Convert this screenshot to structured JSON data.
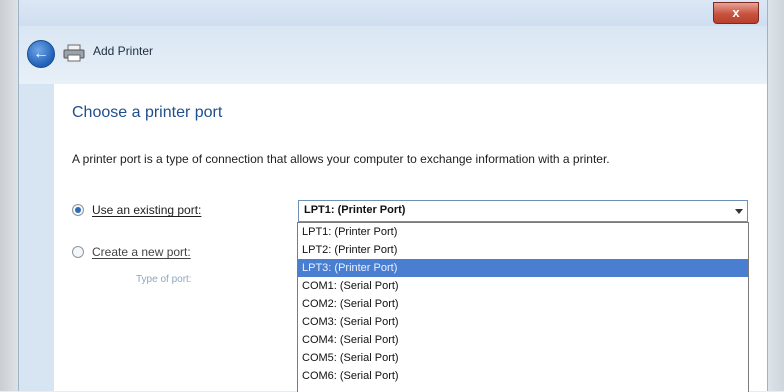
{
  "window": {
    "close_glyph": "x",
    "title": "Add Printer"
  },
  "page": {
    "heading": "Choose a printer port",
    "description": "A printer port is a type of connection that allows your computer to exchange information with a printer."
  },
  "options": {
    "existing_label": "Use an existing port:",
    "existing_selected": true,
    "new_label": "Create a new port:",
    "type_of_port_label": "Type of port:"
  },
  "port_combo": {
    "value": "LPT1: (Printer Port)",
    "items": [
      "LPT1: (Printer Port)",
      "LPT2: (Printer Port)",
      "LPT3: (Printer Port)",
      "COM1: (Serial Port)",
      "COM2: (Serial Port)",
      "COM3: (Serial Port)",
      "COM4: (Serial Port)",
      "COM5: (Serial Port)",
      "COM6: (Serial Port)"
    ],
    "highlighted_index": 2
  },
  "colors": {
    "accent": "#1f4f8c",
    "highlight": "#4a7ed0"
  }
}
